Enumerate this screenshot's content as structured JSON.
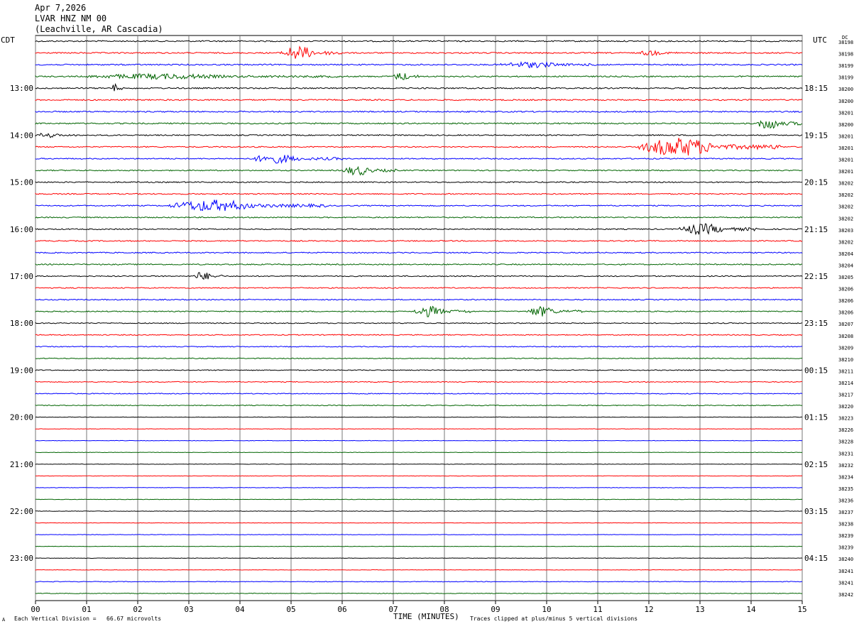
{
  "header": {
    "date": "Apr 7,2026",
    "station": "LVAR HNZ NM 00",
    "location": "(Leachville, AR Cascadia)"
  },
  "left_timezone": "CDT",
  "right_timezone": "UTC",
  "dc_label": "DC",
  "footer": {
    "left_mark": "A",
    "scale_note": "Each Vertical Division =   66.67 microvolts",
    "clip_note": "Traces clipped at plus/minus 5 vertical divisions"
  },
  "colors": {
    "black": "#000000",
    "red": "#ff0000",
    "blue": "#0000ff",
    "green": "#006400",
    "grid": "#777777"
  },
  "chart_data": {
    "type": "line",
    "title": "",
    "xlabel": "TIME (MINUTES)",
    "x_ticks": [
      "00",
      "01",
      "02",
      "03",
      "04",
      "05",
      "06",
      "07",
      "08",
      "09",
      "10",
      "11",
      "12",
      "13",
      "14",
      "15"
    ],
    "xlim": [
      0,
      15
    ],
    "trace_count": 48,
    "trace_colors_cycle": [
      "black",
      "red",
      "blue",
      "green"
    ],
    "left_hour_labels": [
      "13:00",
      "14:00",
      "15:00",
      "16:00",
      "17:00",
      "18:00",
      "19:00",
      "20:00",
      "21:00",
      "22:00",
      "23:00"
    ],
    "right_hour_labels": [
      "18:15",
      "19:15",
      "20:15",
      "21:15",
      "22:15",
      "23:15",
      "00:15",
      "01:15",
      "02:15",
      "03:15",
      "04:15"
    ],
    "dc_offsets": [
      "38198",
      "38198",
      "38199",
      "38199",
      "38200",
      "38200",
      "38201",
      "38200",
      "38201",
      "38201",
      "38201",
      "38201",
      "38202",
      "38202",
      "38202",
      "38202",
      "38203",
      "38202",
      "38204",
      "38204",
      "38205",
      "38206",
      "38206",
      "38206",
      "38207",
      "38208",
      "38209",
      "38210",
      "38211",
      "38214",
      "38217",
      "38220",
      "38223",
      "38226",
      "38228",
      "38231",
      "38232",
      "38234",
      "38235",
      "38236",
      "38237",
      "38238",
      "38239",
      "38239",
      "38240",
      "38241",
      "38241",
      "38242"
    ],
    "noise_level": [
      0.3,
      0.3,
      0.3,
      0.3,
      0.3,
      0.3,
      0.3,
      0.3,
      0.26,
      0.26,
      0.26,
      0.26,
      0.26,
      0.26,
      0.26,
      0.26,
      0.26,
      0.26,
      0.26,
      0.26,
      0.24,
      0.24,
      0.24,
      0.24,
      0.22,
      0.22,
      0.2,
      0.2,
      0.2,
      0.2,
      0.2,
      0.2,
      0.1,
      0.1,
      0.1,
      0.1,
      0.1,
      0.1,
      0.1,
      0.1,
      0.1,
      0.1,
      0.1,
      0.1,
      0.1,
      0.1,
      0.14,
      0.14
    ],
    "events": [
      {
        "trace": 1,
        "start_min": 4.8,
        "end_min": 6.0,
        "amplitude": 1.8
      },
      {
        "trace": 1,
        "start_min": 11.8,
        "end_min": 12.6,
        "amplitude": 0.6
      },
      {
        "trace": 2,
        "start_min": 9.1,
        "end_min": 11.2,
        "amplitude": 0.7
      },
      {
        "trace": 3,
        "start_min": 1.0,
        "end_min": 6.0,
        "amplitude": 0.6
      },
      {
        "trace": 3,
        "start_min": 7.0,
        "end_min": 7.6,
        "amplitude": 1.0
      },
      {
        "trace": 4,
        "start_min": 1.5,
        "end_min": 1.7,
        "amplitude": 1.2
      },
      {
        "trace": 7,
        "start_min": 14.1,
        "end_min": 15.0,
        "amplitude": 1.5
      },
      {
        "trace": 8,
        "start_min": 0.0,
        "end_min": 0.8,
        "amplitude": 0.6
      },
      {
        "trace": 9,
        "start_min": 11.8,
        "end_min": 14.6,
        "amplitude": 2.5
      },
      {
        "trace": 10,
        "start_min": 4.2,
        "end_min": 6.0,
        "amplitude": 1.1
      },
      {
        "trace": 11,
        "start_min": 6.0,
        "end_min": 7.1,
        "amplitude": 1.2
      },
      {
        "trace": 14,
        "start_min": 2.6,
        "end_min": 5.7,
        "amplitude": 1.5
      },
      {
        "trace": 16,
        "start_min": 12.6,
        "end_min": 14.2,
        "amplitude": 1.4
      },
      {
        "trace": 20,
        "start_min": 3.1,
        "end_min": 3.7,
        "amplitude": 1.2
      },
      {
        "trace": 23,
        "start_min": 7.4,
        "end_min": 8.5,
        "amplitude": 1.4
      },
      {
        "trace": 23,
        "start_min": 9.6,
        "end_min": 10.7,
        "amplitude": 1.3
      }
    ]
  }
}
